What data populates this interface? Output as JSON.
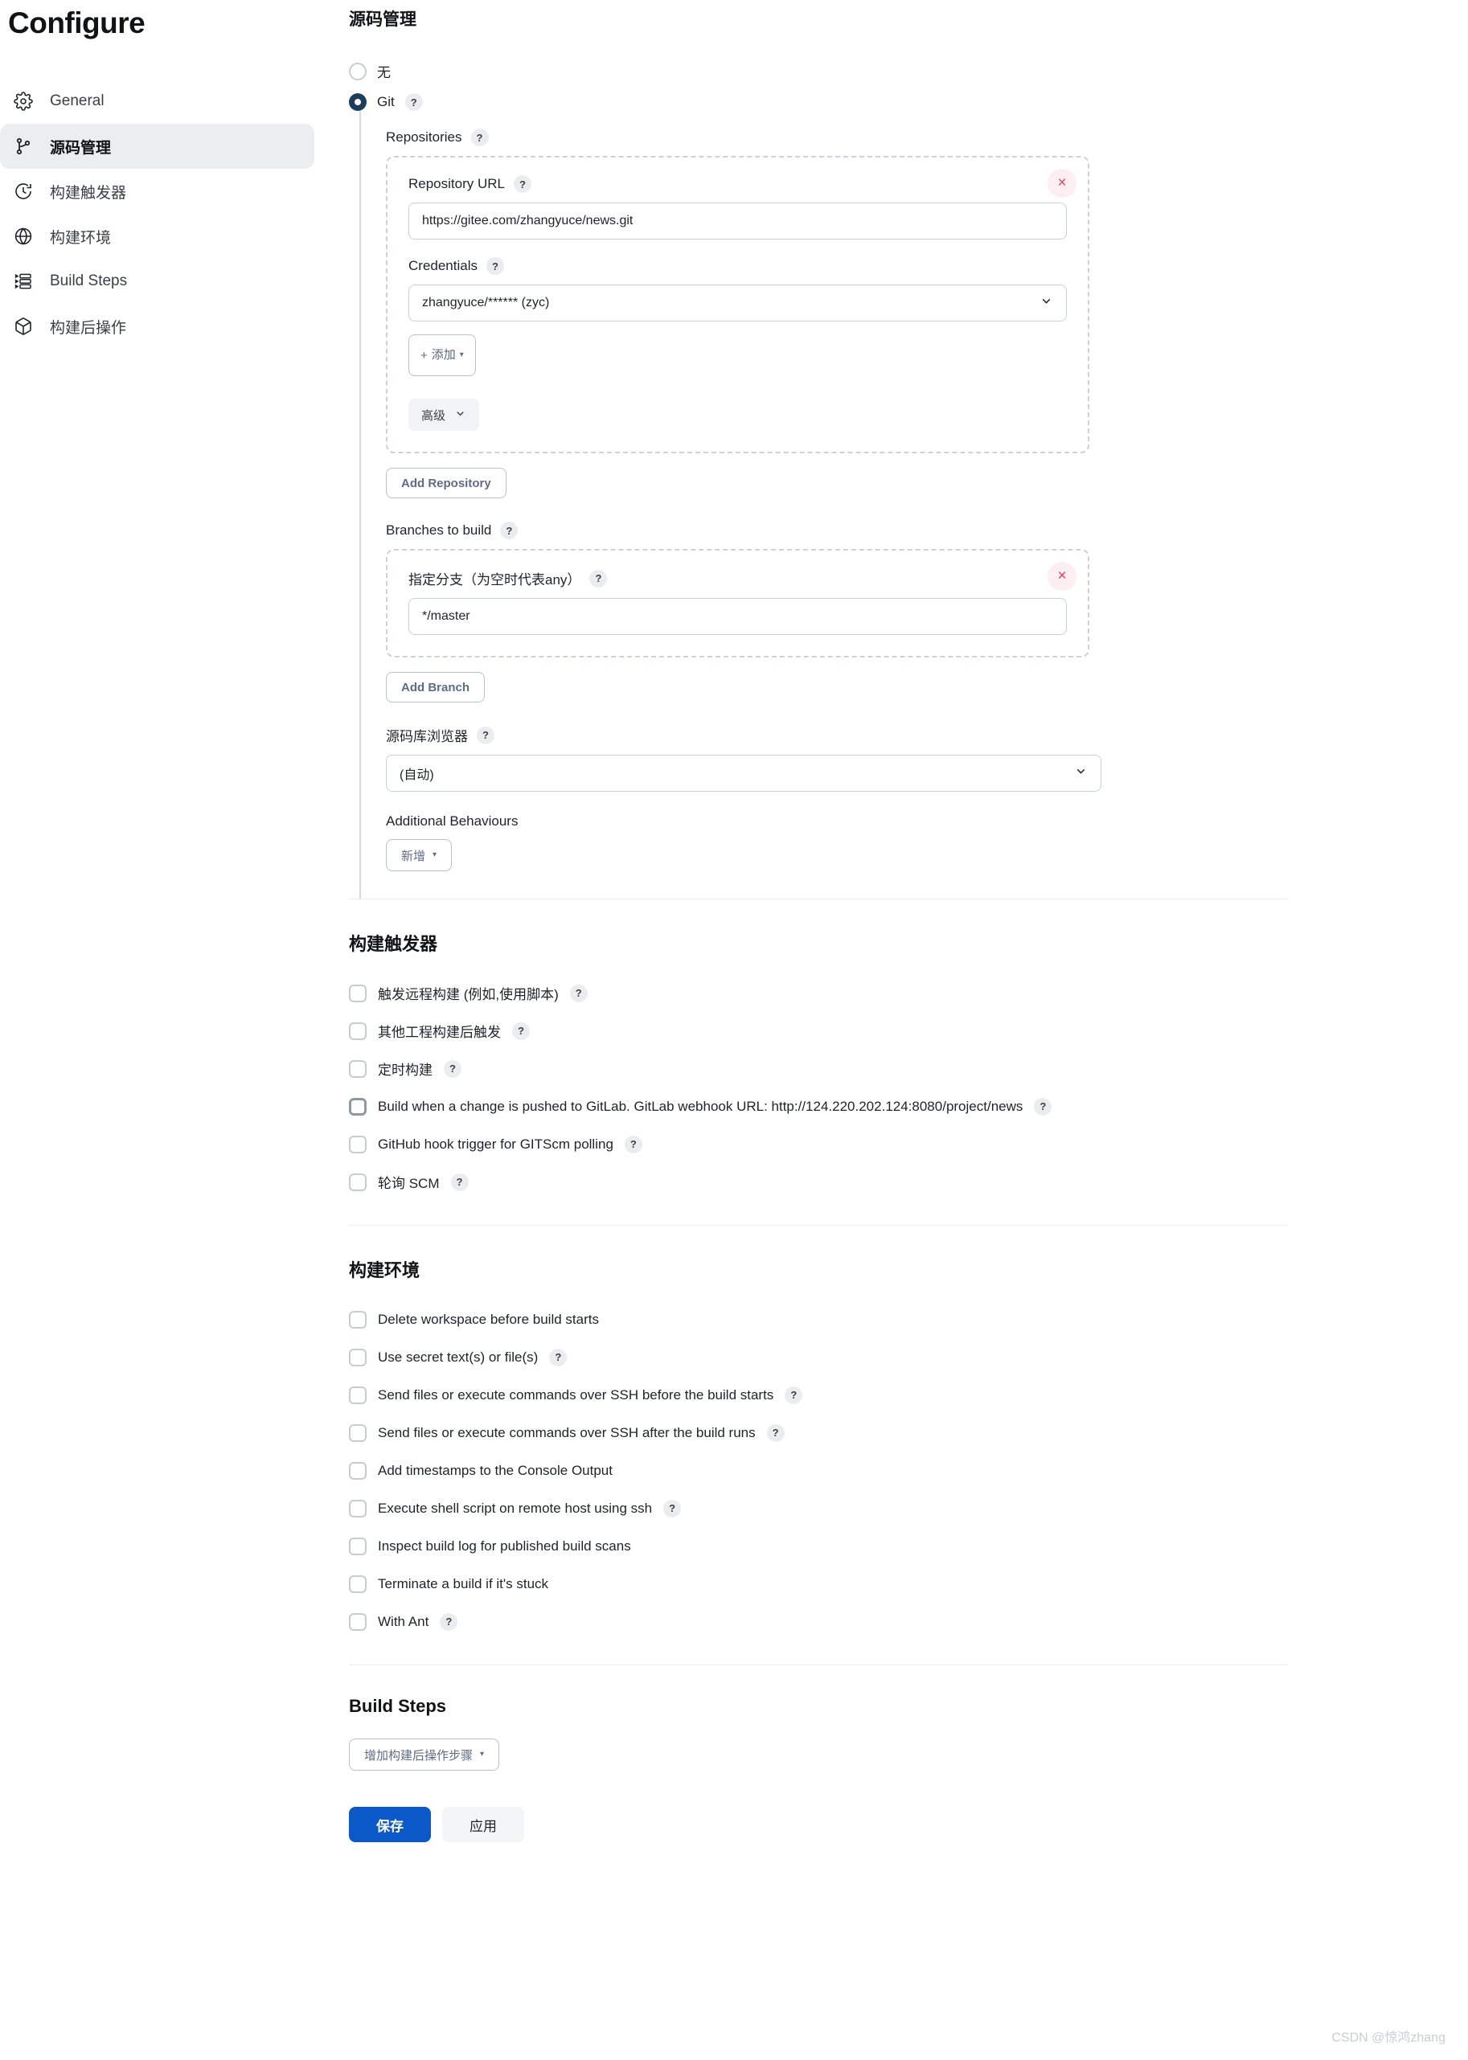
{
  "sidebar": {
    "title": "Configure",
    "items": [
      {
        "label": "General",
        "icon": "gear-icon",
        "active": false
      },
      {
        "label": "源码管理",
        "icon": "git-branch-icon",
        "active": true
      },
      {
        "label": "构建触发器",
        "icon": "clock-icon",
        "active": false
      },
      {
        "label": "构建环境",
        "icon": "globe-icon",
        "active": false
      },
      {
        "label": "Build Steps",
        "icon": "list-steps-icon",
        "active": false
      },
      {
        "label": "构建后操作",
        "icon": "package-icon",
        "active": false
      }
    ]
  },
  "scm": {
    "heading": "源码管理",
    "options": [
      {
        "label": "无",
        "checked": false,
        "help": false
      },
      {
        "label": "Git",
        "checked": true,
        "help": true
      }
    ],
    "repositories_label": "Repositories",
    "repository_url_label": "Repository URL",
    "repository_url_value": "https://gitee.com/zhangyuce/news.git",
    "credentials_label": "Credentials",
    "credentials_value": "zhangyuce/****** (zyc)",
    "add_credentials_label": "添加",
    "advanced_label": "高级",
    "add_repository_label": "Add Repository",
    "branches_label": "Branches to build",
    "branch_specifier_label": "指定分支（为空时代表any）",
    "branch_specifier_value": "*/master",
    "add_branch_label": "Add Branch",
    "repo_browser_label": "源码库浏览器",
    "repo_browser_value": "(自动)",
    "additional_behaviours_label": "Additional Behaviours",
    "add_behaviour_label": "新增",
    "delete_icon": "×"
  },
  "triggers": {
    "heading": "构建触发器",
    "items": [
      {
        "label": "触发远程构建 (例如,使用脚本)",
        "checked": false,
        "help": true,
        "focused": false
      },
      {
        "label": "其他工程构建后触发",
        "checked": false,
        "help": true,
        "focused": false
      },
      {
        "label": "定时构建",
        "checked": false,
        "help": true,
        "focused": false
      },
      {
        "label": "Build when a change is pushed to GitLab. GitLab webhook URL: http://124.220.202.124:8080/project/news",
        "checked": false,
        "help": true,
        "focused": true
      },
      {
        "label": "GitHub hook trigger for GITScm polling",
        "checked": false,
        "help": true,
        "focused": false
      },
      {
        "label": "轮询 SCM",
        "checked": false,
        "help": true,
        "focused": false
      }
    ]
  },
  "environment": {
    "heading": "构建环境",
    "items": [
      {
        "label": "Delete workspace before build starts",
        "checked": false,
        "help": false
      },
      {
        "label": "Use secret text(s) or file(s)",
        "checked": false,
        "help": true
      },
      {
        "label": "Send files or execute commands over SSH before the build starts",
        "checked": false,
        "help": true
      },
      {
        "label": "Send files or execute commands over SSH after the build runs",
        "checked": false,
        "help": true
      },
      {
        "label": "Add timestamps to the Console Output",
        "checked": false,
        "help": false
      },
      {
        "label": "Execute shell script on remote host using ssh",
        "checked": false,
        "help": true
      },
      {
        "label": "Inspect build log for published build scans",
        "checked": false,
        "help": false
      },
      {
        "label": "Terminate a build if it's stuck",
        "checked": false,
        "help": false
      },
      {
        "label": "With Ant",
        "checked": false,
        "help": true
      }
    ]
  },
  "build_steps": {
    "heading": "Build Steps",
    "add_step_label": "增加构建后操作步骤"
  },
  "footer": {
    "save_label": "保存",
    "apply_label": "应用"
  },
  "watermark": "CSDN @惊鸿zhang",
  "colors": {
    "accent": "#0b59c9",
    "radio_selected": "#1b3d5e",
    "delete": "#e8415a",
    "sidebar_active_bg": "#ebedef"
  }
}
